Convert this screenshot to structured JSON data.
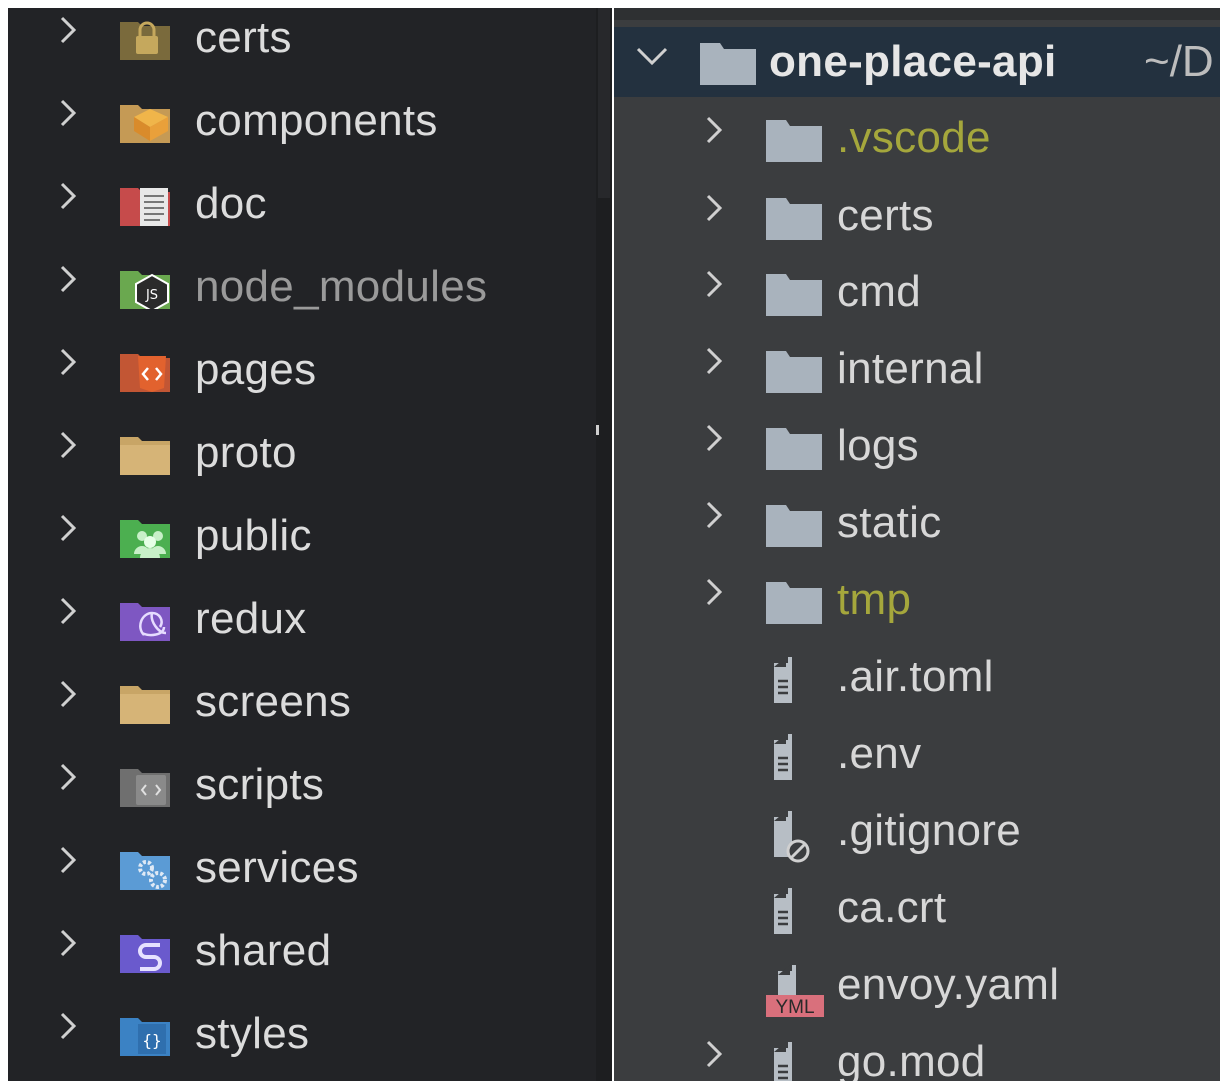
{
  "left_tree": {
    "items": [
      {
        "label": "certs",
        "icon": "lock-folder-icon"
      },
      {
        "label": "components",
        "icon": "components-folder-icon"
      },
      {
        "label": "doc",
        "icon": "doc-folder-icon"
      },
      {
        "label": "node_modules",
        "icon": "nodejs-folder-icon"
      },
      {
        "label": "pages",
        "icon": "pages-folder-icon"
      },
      {
        "label": "proto",
        "icon": "folder-icon"
      },
      {
        "label": "public",
        "icon": "public-folder-icon"
      },
      {
        "label": "redux",
        "icon": "redux-folder-icon"
      },
      {
        "label": "screens",
        "icon": "folder-icon"
      },
      {
        "label": "scripts",
        "icon": "scripts-folder-icon"
      },
      {
        "label": "services",
        "icon": "services-folder-icon"
      },
      {
        "label": "shared",
        "icon": "shared-folder-icon"
      },
      {
        "label": "styles",
        "icon": "styles-folder-icon"
      }
    ]
  },
  "right_tree": {
    "root": {
      "label": "one-place-api",
      "path": "~/D",
      "icon": "folder-icon"
    },
    "items": [
      {
        "label": ".vscode",
        "icon": "folder-icon",
        "type": "folder"
      },
      {
        "label": "certs",
        "icon": "folder-icon",
        "type": "folder"
      },
      {
        "label": "cmd",
        "icon": "folder-icon",
        "type": "folder"
      },
      {
        "label": "internal",
        "icon": "folder-icon",
        "type": "folder"
      },
      {
        "label": "logs",
        "icon": "folder-icon",
        "type": "folder"
      },
      {
        "label": "static",
        "icon": "folder-icon",
        "type": "folder"
      },
      {
        "label": "tmp",
        "icon": "folder-icon",
        "type": "folder"
      },
      {
        "label": ".air.toml",
        "icon": "text-file-icon",
        "type": "file"
      },
      {
        "label": ".env",
        "icon": "text-file-icon",
        "type": "file"
      },
      {
        "label": ".gitignore",
        "icon": "ignore-file-icon",
        "type": "file"
      },
      {
        "label": "ca.crt",
        "icon": "text-file-icon",
        "type": "file"
      },
      {
        "label": "envoy.yaml",
        "icon": "yaml-file-icon",
        "type": "file",
        "badge": "YML"
      },
      {
        "label": "go.mod",
        "icon": "text-file-icon",
        "type": "file"
      }
    ]
  },
  "colors": {
    "left_bg": "#222326",
    "right_bg": "#3b3d3f",
    "root_highlight": "#23313f",
    "ignored_text": "#a5a73c",
    "yaml_badge": "#d9707c"
  }
}
